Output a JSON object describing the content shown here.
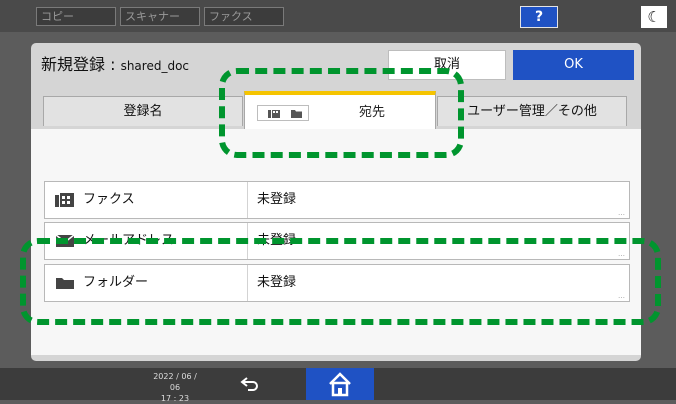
{
  "topbar": {
    "apps": [
      "コピー",
      "スキャナー",
      "ファクス"
    ],
    "help_label": "?",
    "night_icon": "moon-icon"
  },
  "dialog": {
    "title": "新規登録 : ",
    "file_name": "shared_doc",
    "cancel_label": "取消",
    "ok_label": "OK"
  },
  "tabs": {
    "names_label": "登録名",
    "destination_label": "宛先",
    "user_mgmt_label": "ユーザー管理／その他"
  },
  "rows": [
    {
      "label": "ファクス",
      "value": "未登録",
      "icon": "fax-icon"
    },
    {
      "label": "メールアドレス",
      "value": "未登録",
      "icon": "mail-icon"
    },
    {
      "label": "フォルダー",
      "value": "未登録",
      "icon": "folder-icon"
    }
  ],
  "bottombar": {
    "date": "2022 / 06 / 06",
    "time": "17 : 23",
    "back_icon": "back-arrow-icon",
    "home_icon": "home-icon"
  },
  "colors": {
    "accent_blue": "#1f52c4",
    "tab_highlight": "#f5c400",
    "callout_green": "#00952e"
  }
}
